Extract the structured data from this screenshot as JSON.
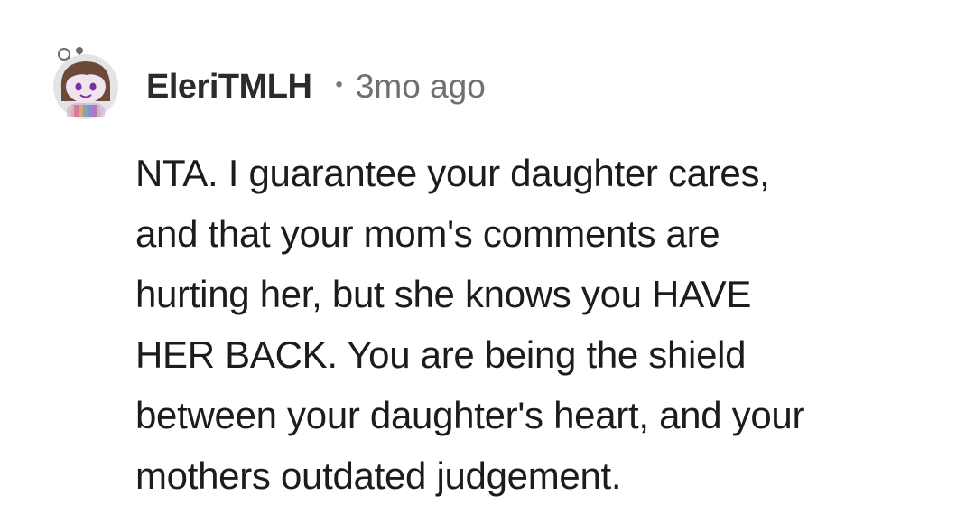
{
  "comment": {
    "author": "EleriTMLH",
    "separator": "•",
    "timestamp": "3mo ago",
    "avatar_icon": "reddit-snoo-avatar-icon",
    "body_lines": [
      "NTA. I guarantee your daughter cares,",
      "and that your mom's comments are",
      "hurting her, but she knows you HAVE",
      "HER BACK. You are being the shield",
      "between your daughter's heart, and your",
      "mothers outdated judgement."
    ]
  },
  "colors": {
    "background": "#ffffff",
    "username": "#2b2b2b",
    "meta": "#6f6f6f",
    "body": "#1c1c1c"
  }
}
